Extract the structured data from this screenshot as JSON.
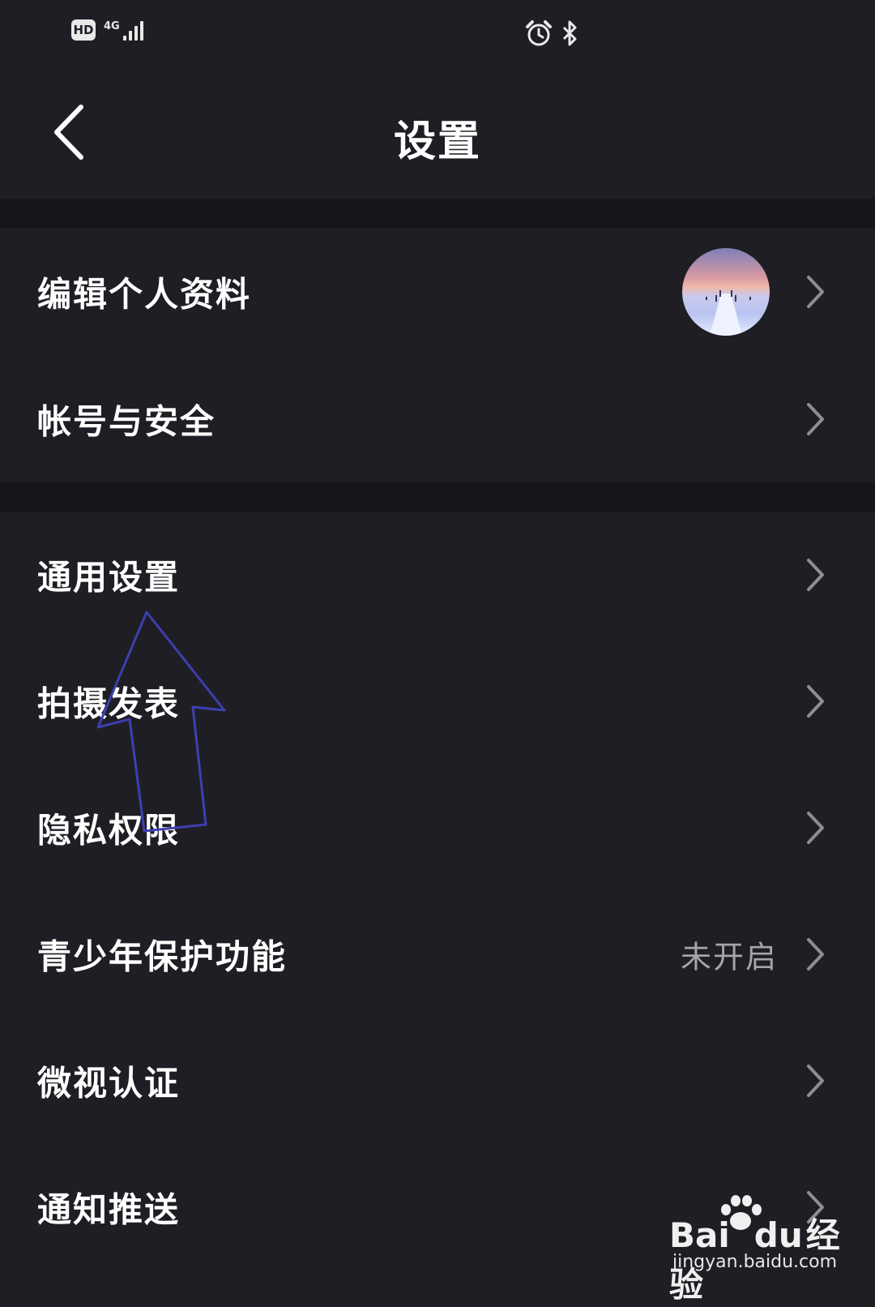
{
  "status_bar": {
    "hd_badge": "HD",
    "network_type": "4G",
    "icons": [
      "hd-icon",
      "signal-icon",
      "alarm-icon",
      "bluetooth-icon"
    ]
  },
  "header": {
    "title": "设置",
    "back_icon": "chevron-left-icon"
  },
  "sections": [
    {
      "items": [
        {
          "label": "编辑个人资料",
          "has_avatar": true
        },
        {
          "label": "帐号与安全"
        }
      ]
    },
    {
      "items": [
        {
          "label": "通用设置"
        },
        {
          "label": "拍摄发表"
        },
        {
          "label": "隐私权限"
        },
        {
          "label": "青少年保护功能",
          "value": "未开启"
        },
        {
          "label": "微视认证"
        },
        {
          "label": "通知推送"
        }
      ]
    }
  ],
  "watermark": {
    "brand_text": "Bai",
    "brand_text_2": "du",
    "brand_suffix": "经验",
    "url": "jingyan.baidu.com"
  },
  "colors": {
    "background": "#1f1e24",
    "section_divider": "#16151a",
    "text_primary": "#ffffff",
    "text_secondary": "#a5a4aa",
    "chevron": "#8e8d93",
    "annotation_arrow": "#3d3fb0"
  }
}
